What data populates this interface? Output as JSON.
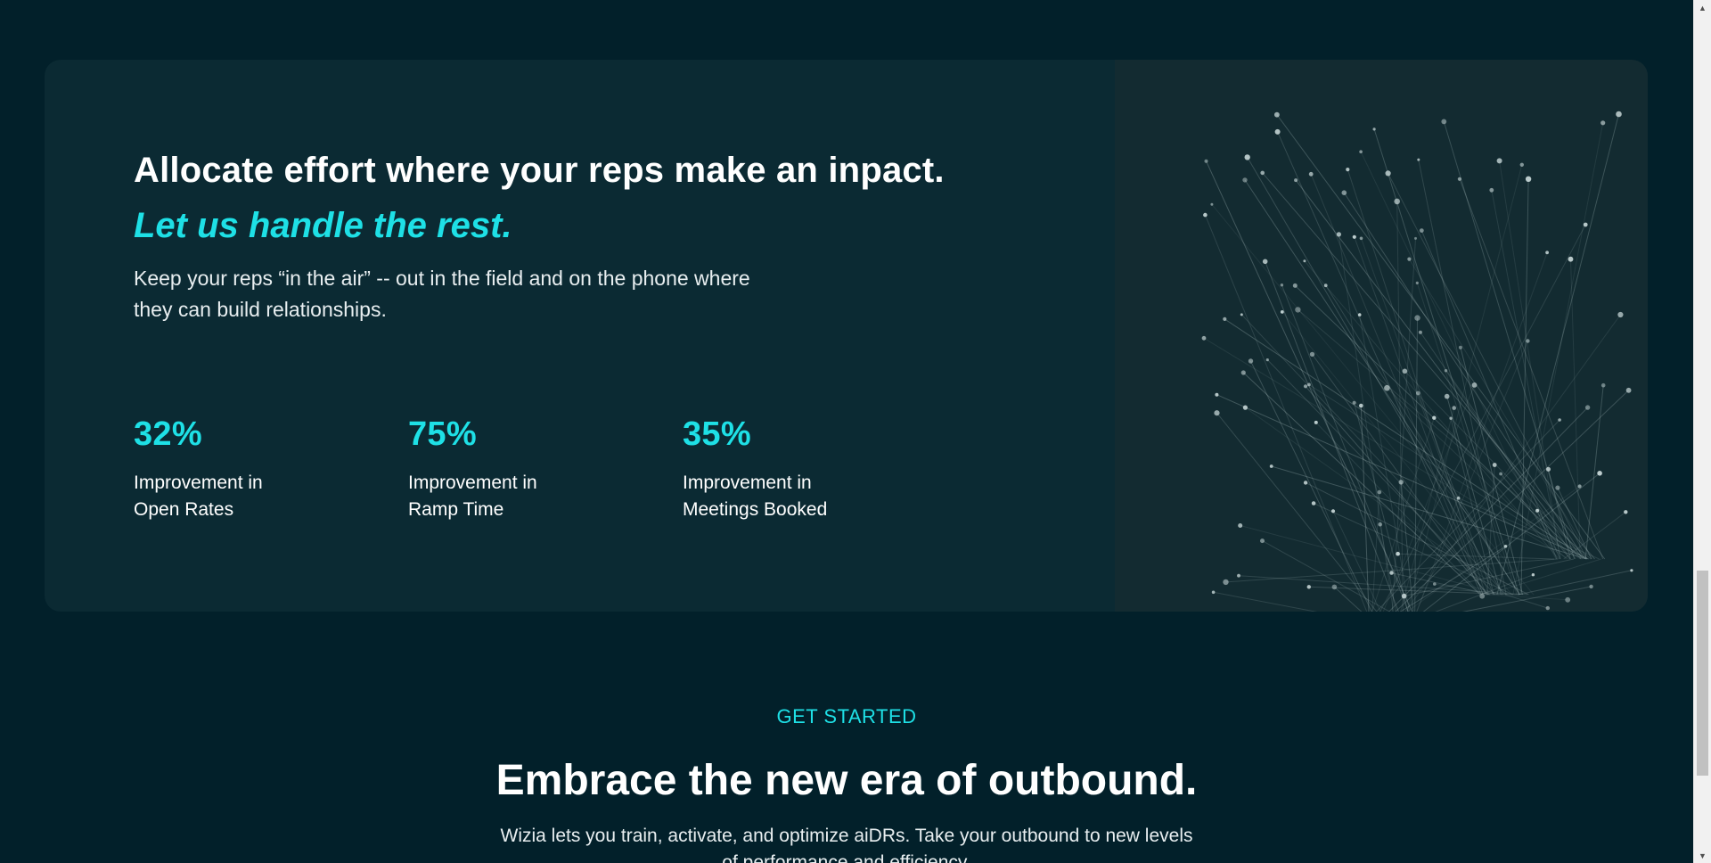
{
  "feature": {
    "headline": "Allocate effort where your reps make an inpact.",
    "subheadline": "Let us handle the rest.",
    "lead": "Keep your reps “in the air” -- out in the field and on the phone where they can build relationships.",
    "stats": [
      {
        "value": "32%",
        "label": "Improvement in Open Rates"
      },
      {
        "value": "75%",
        "label": "Improvement in Ramp Time"
      },
      {
        "value": "35%",
        "label": "Improvement in Meetings Booked"
      }
    ]
  },
  "get_started": {
    "eyebrow": "GET STARTED",
    "title": "Embrace the new era of outbound.",
    "text": "Wizia lets you train, activate, and optimize aiDRs. Take your outbound to new levels of performance and efficiency."
  },
  "colors": {
    "background": "#02202a",
    "card": "#0b2a33",
    "accent": "#1ee0e6",
    "art_panel": "#132b31"
  },
  "icons": {
    "scroll_up": "scroll-up-arrow-icon",
    "scroll_down": "scroll-down-arrow-icon"
  }
}
